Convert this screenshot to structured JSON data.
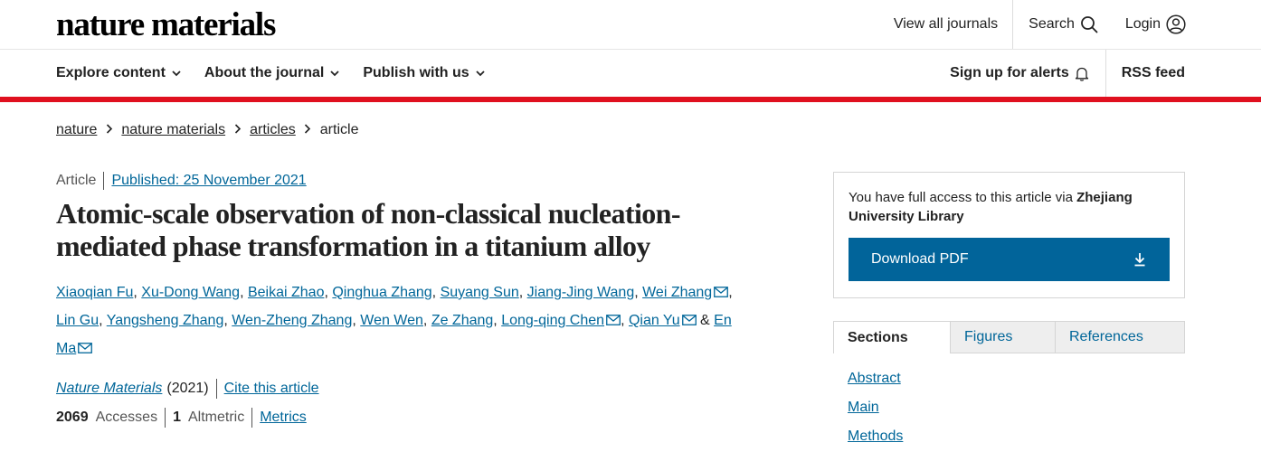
{
  "header": {
    "logo": "nature materials",
    "view_all_journals": "View all journals",
    "search": "Search",
    "login": "Login"
  },
  "nav": {
    "items": [
      {
        "label": "Explore content"
      },
      {
        "label": "About the journal"
      },
      {
        "label": "Publish with us"
      }
    ],
    "alerts": "Sign up for alerts",
    "rss": "RSS feed"
  },
  "colors": {
    "accent_red": "#e0101f",
    "link_blue": "#006699",
    "button_blue": "#01649a"
  },
  "breadcrumb": {
    "items": [
      "nature",
      "nature materials",
      "articles"
    ],
    "current": "article"
  },
  "article": {
    "type": "Article",
    "published": "Published: 25 November 2021",
    "title_line1": "Atomic-scale observation of non-classical nucleation-",
    "title_line2": "mediated phase transformation in a titanium alloy",
    "authors": {
      "a1": "Xiaoqian Fu",
      "a2": "Xu-Dong Wang",
      "a3": "Beikai Zhao",
      "a4": "Qinghua Zhang",
      "a5": "Suyang Sun",
      "a6": "Jiang-Jing Wang",
      "a7": "Wei Zhang",
      "a8": "Lin Gu",
      "a9": "Yangsheng Zhang",
      "a10": "Wen-Zheng Zhang",
      "a11": "Wen Wen",
      "a12": "Ze Zhang",
      "a13": "Long-qing Chen",
      "a14": "Qian Yu",
      "a15": "En Ma"
    },
    "journal": "Nature Materials",
    "year": "(2021)",
    "cite": "Cite this article",
    "accesses_count": "2069",
    "accesses_label": "Accesses",
    "altmetric_count": "1",
    "altmetric_label": "Altmetric",
    "metrics": "Metrics"
  },
  "access": {
    "text_prefix": "You have full access to this article via",
    "institution": "Zhejiang University Library",
    "download": "Download PDF"
  },
  "tabs": {
    "sections": "Sections",
    "figures": "Figures",
    "references": "References"
  },
  "sections": [
    "Abstract",
    "Main",
    "Methods"
  ]
}
